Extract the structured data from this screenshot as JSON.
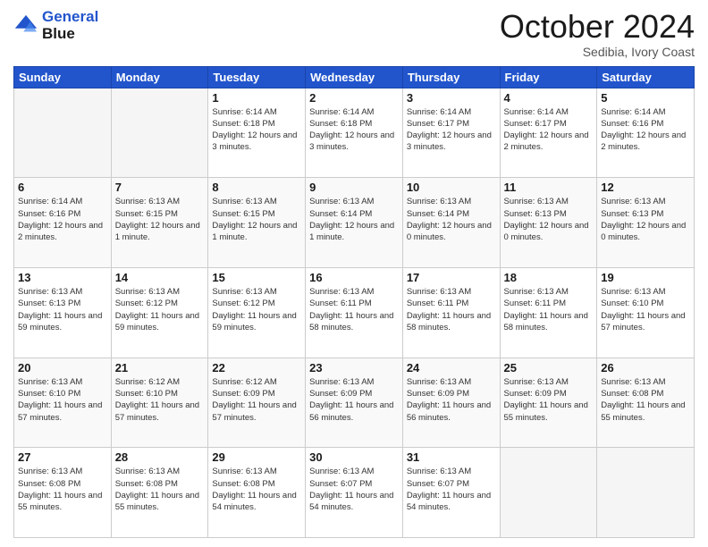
{
  "logo": {
    "line1": "General",
    "line2": "Blue"
  },
  "title": "October 2024",
  "subtitle": "Sedibia, Ivory Coast",
  "days_of_week": [
    "Sunday",
    "Monday",
    "Tuesday",
    "Wednesday",
    "Thursday",
    "Friday",
    "Saturday"
  ],
  "weeks": [
    [
      {
        "day": "",
        "info": ""
      },
      {
        "day": "",
        "info": ""
      },
      {
        "day": "1",
        "info": "Sunrise: 6:14 AM\nSunset: 6:18 PM\nDaylight: 12 hours and 3 minutes."
      },
      {
        "day": "2",
        "info": "Sunrise: 6:14 AM\nSunset: 6:18 PM\nDaylight: 12 hours and 3 minutes."
      },
      {
        "day": "3",
        "info": "Sunrise: 6:14 AM\nSunset: 6:17 PM\nDaylight: 12 hours and 3 minutes."
      },
      {
        "day": "4",
        "info": "Sunrise: 6:14 AM\nSunset: 6:17 PM\nDaylight: 12 hours and 2 minutes."
      },
      {
        "day": "5",
        "info": "Sunrise: 6:14 AM\nSunset: 6:16 PM\nDaylight: 12 hours and 2 minutes."
      }
    ],
    [
      {
        "day": "6",
        "info": "Sunrise: 6:14 AM\nSunset: 6:16 PM\nDaylight: 12 hours and 2 minutes."
      },
      {
        "day": "7",
        "info": "Sunrise: 6:13 AM\nSunset: 6:15 PM\nDaylight: 12 hours and 1 minute."
      },
      {
        "day": "8",
        "info": "Sunrise: 6:13 AM\nSunset: 6:15 PM\nDaylight: 12 hours and 1 minute."
      },
      {
        "day": "9",
        "info": "Sunrise: 6:13 AM\nSunset: 6:14 PM\nDaylight: 12 hours and 1 minute."
      },
      {
        "day": "10",
        "info": "Sunrise: 6:13 AM\nSunset: 6:14 PM\nDaylight: 12 hours and 0 minutes."
      },
      {
        "day": "11",
        "info": "Sunrise: 6:13 AM\nSunset: 6:13 PM\nDaylight: 12 hours and 0 minutes."
      },
      {
        "day": "12",
        "info": "Sunrise: 6:13 AM\nSunset: 6:13 PM\nDaylight: 12 hours and 0 minutes."
      }
    ],
    [
      {
        "day": "13",
        "info": "Sunrise: 6:13 AM\nSunset: 6:13 PM\nDaylight: 11 hours and 59 minutes."
      },
      {
        "day": "14",
        "info": "Sunrise: 6:13 AM\nSunset: 6:12 PM\nDaylight: 11 hours and 59 minutes."
      },
      {
        "day": "15",
        "info": "Sunrise: 6:13 AM\nSunset: 6:12 PM\nDaylight: 11 hours and 59 minutes."
      },
      {
        "day": "16",
        "info": "Sunrise: 6:13 AM\nSunset: 6:11 PM\nDaylight: 11 hours and 58 minutes."
      },
      {
        "day": "17",
        "info": "Sunrise: 6:13 AM\nSunset: 6:11 PM\nDaylight: 11 hours and 58 minutes."
      },
      {
        "day": "18",
        "info": "Sunrise: 6:13 AM\nSunset: 6:11 PM\nDaylight: 11 hours and 58 minutes."
      },
      {
        "day": "19",
        "info": "Sunrise: 6:13 AM\nSunset: 6:10 PM\nDaylight: 11 hours and 57 minutes."
      }
    ],
    [
      {
        "day": "20",
        "info": "Sunrise: 6:13 AM\nSunset: 6:10 PM\nDaylight: 11 hours and 57 minutes."
      },
      {
        "day": "21",
        "info": "Sunrise: 6:12 AM\nSunset: 6:10 PM\nDaylight: 11 hours and 57 minutes."
      },
      {
        "day": "22",
        "info": "Sunrise: 6:12 AM\nSunset: 6:09 PM\nDaylight: 11 hours and 57 minutes."
      },
      {
        "day": "23",
        "info": "Sunrise: 6:13 AM\nSunset: 6:09 PM\nDaylight: 11 hours and 56 minutes."
      },
      {
        "day": "24",
        "info": "Sunrise: 6:13 AM\nSunset: 6:09 PM\nDaylight: 11 hours and 56 minutes."
      },
      {
        "day": "25",
        "info": "Sunrise: 6:13 AM\nSunset: 6:09 PM\nDaylight: 11 hours and 55 minutes."
      },
      {
        "day": "26",
        "info": "Sunrise: 6:13 AM\nSunset: 6:08 PM\nDaylight: 11 hours and 55 minutes."
      }
    ],
    [
      {
        "day": "27",
        "info": "Sunrise: 6:13 AM\nSunset: 6:08 PM\nDaylight: 11 hours and 55 minutes."
      },
      {
        "day": "28",
        "info": "Sunrise: 6:13 AM\nSunset: 6:08 PM\nDaylight: 11 hours and 55 minutes."
      },
      {
        "day": "29",
        "info": "Sunrise: 6:13 AM\nSunset: 6:08 PM\nDaylight: 11 hours and 54 minutes."
      },
      {
        "day": "30",
        "info": "Sunrise: 6:13 AM\nSunset: 6:07 PM\nDaylight: 11 hours and 54 minutes."
      },
      {
        "day": "31",
        "info": "Sunrise: 6:13 AM\nSunset: 6:07 PM\nDaylight: 11 hours and 54 minutes."
      },
      {
        "day": "",
        "info": ""
      },
      {
        "day": "",
        "info": ""
      }
    ]
  ]
}
